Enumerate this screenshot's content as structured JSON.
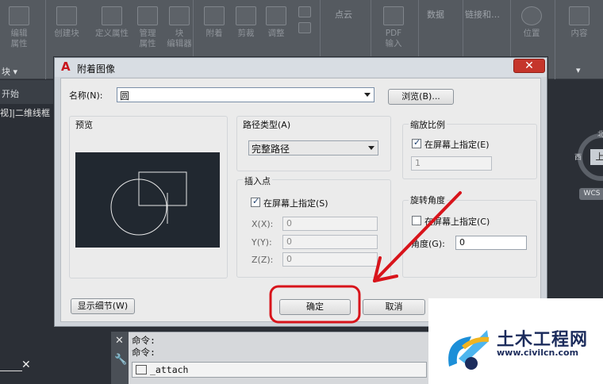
{
  "ribbon": {
    "tools": [
      {
        "label": "编辑\n属性",
        "dim": true
      },
      {
        "label": "创建块",
        "dim": true
      },
      {
        "label": "定义属性",
        "dim": true
      },
      {
        "label": "管理\n属性",
        "dim": true
      },
      {
        "label": "块\n编辑器",
        "dim": true
      },
      {
        "label": "附着",
        "dim": true
      },
      {
        "label": "剪裁",
        "dim": true
      },
      {
        "label": "调整",
        "dim": true
      },
      {
        "label": "PDF\n输入",
        "dim": true
      },
      {
        "label": "位置",
        "dim": true
      },
      {
        "label": "内容",
        "dim": true
      }
    ],
    "panel_labels": [
      "点云",
      "数据",
      "链接和…"
    ],
    "block_panel_label": "块 ▾",
    "tab_label": "开始"
  },
  "viewport": {
    "label": "视]|二维线框",
    "compass_top": "北",
    "compass_left": "西",
    "cube_label": "上",
    "wcs_label": "WCS"
  },
  "dialog": {
    "title": "附着图像",
    "name_label": "名称(N):",
    "name_value": "圆",
    "browse_label": "浏览(B)...",
    "preview_label": "预览",
    "path_type_label": "路径类型(A)",
    "path_type_value": "完整路径",
    "insertion_label": "插入点",
    "insertion_onscreen": "在屏幕上指定(S)",
    "x_label": "X(X):",
    "y_label": "Y(Y):",
    "z_label": "Z(Z):",
    "x_value": "0",
    "y_value": "0",
    "z_value": "0",
    "scale_label": "缩放比例",
    "scale_onscreen": "在屏幕上指定(E)",
    "scale_value": "1",
    "rotation_label": "旋转角度",
    "rotation_onscreen": "在屏幕上指定(C)",
    "angle_label": "角度(G):",
    "angle_value": "0",
    "details_label": "显示细节(W)",
    "ok_label": "确定",
    "cancel_label": "取消"
  },
  "command": {
    "history": [
      "命令:",
      "命令:"
    ],
    "input": "_attach"
  },
  "watermark": {
    "brand": "土木工程网",
    "url": "www.civilcn.com"
  },
  "colors": {
    "annotation": "#d8141b",
    "ribbon": "#555a60",
    "dialog": "#ebebeb"
  }
}
